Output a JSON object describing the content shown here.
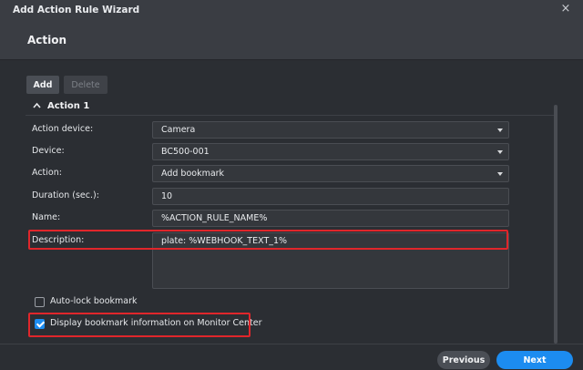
{
  "window": {
    "title": "Add Action Rule Wizard",
    "close_icon": "×"
  },
  "header": {
    "title": "Action"
  },
  "toolbar": {
    "add_label": "Add",
    "delete_label": "Delete"
  },
  "section": {
    "chevron": "^",
    "title": "Action 1"
  },
  "form": {
    "action_device": {
      "label": "Action device:",
      "value": "Camera"
    },
    "device": {
      "label": "Device:",
      "value": "BC500-001"
    },
    "action": {
      "label": "Action:",
      "value": "Add bookmark"
    },
    "duration": {
      "label": "Duration (sec.):",
      "value": "10"
    },
    "name": {
      "label": "Name:",
      "value": "%ACTION_RULE_NAME%"
    },
    "description": {
      "label": "Description:",
      "value": "plate: %WEBHOOK_TEXT_1%"
    }
  },
  "checkboxes": {
    "auto_lock": {
      "label": "Auto-lock bookmark",
      "checked": false
    },
    "display_info": {
      "label": "Display bookmark information on Monitor Center",
      "checked": true
    }
  },
  "footer": {
    "previous_label": "Previous",
    "next_label": "Next"
  },
  "colors": {
    "accent": "#1c8cf0",
    "highlight": "#e0262b"
  }
}
